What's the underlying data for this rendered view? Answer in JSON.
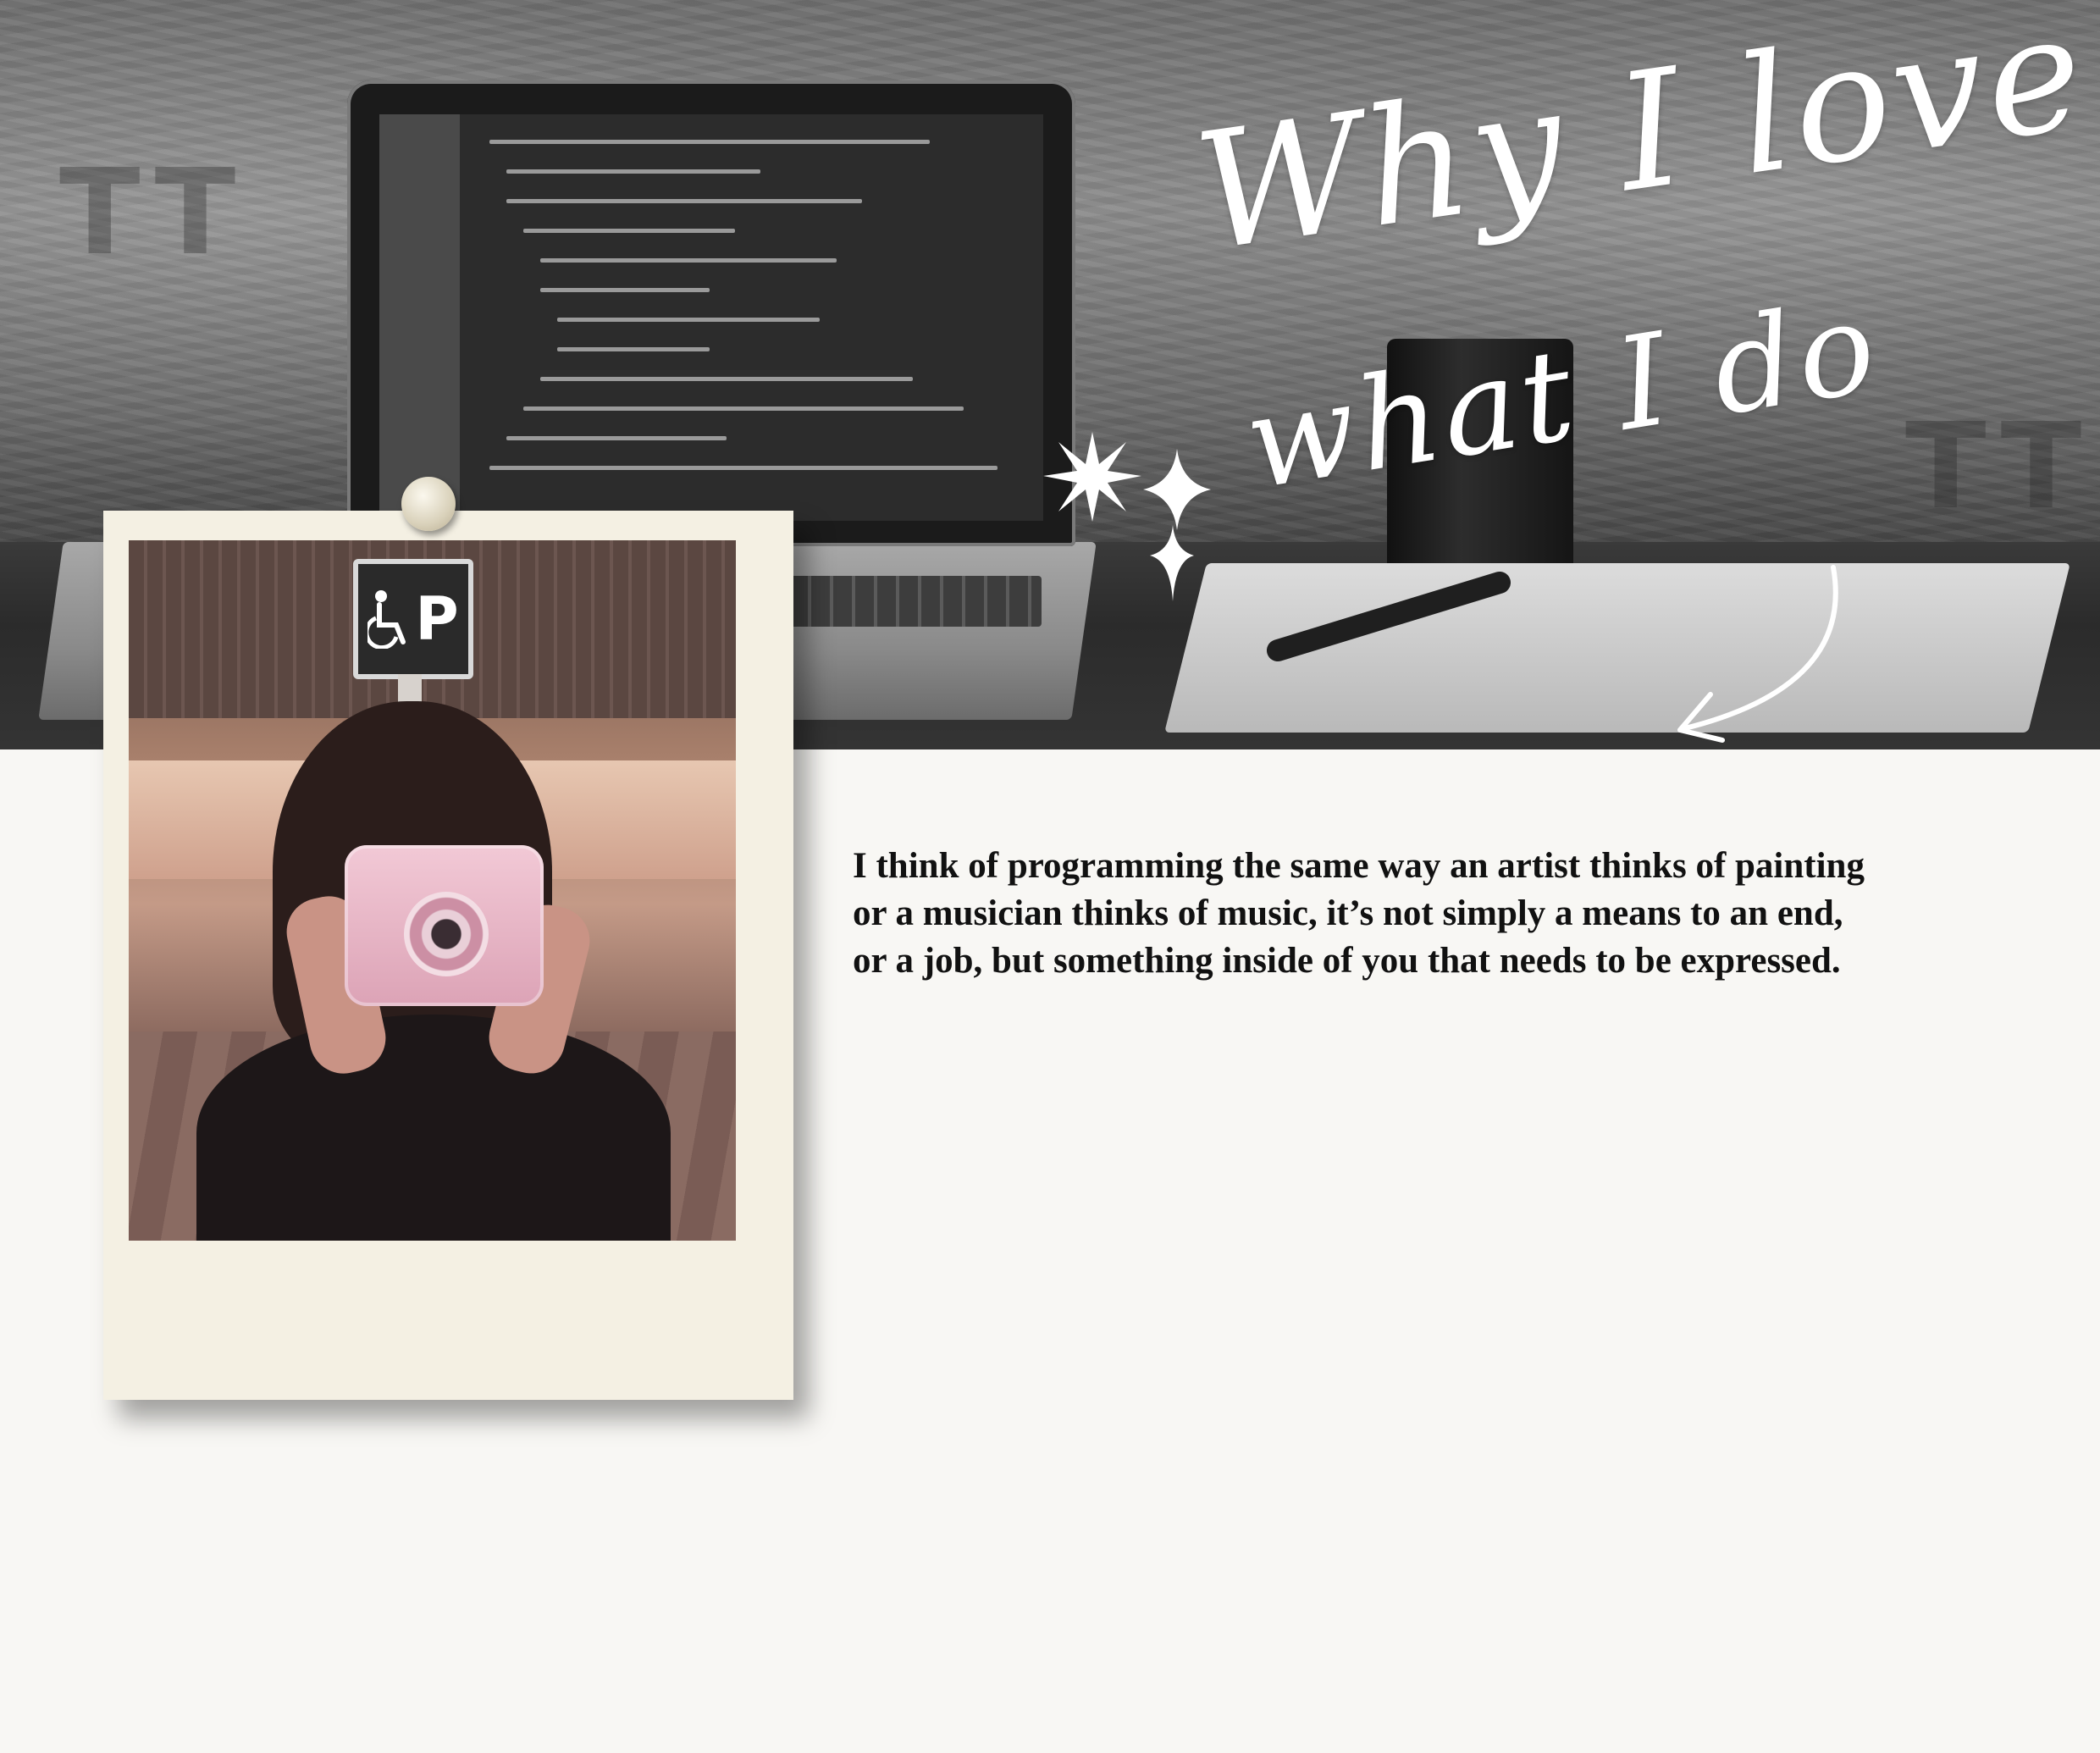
{
  "title": {
    "line1": "Why I love",
    "line2": "what I do"
  },
  "quote": {
    "lines": [
      "I think of programming the same way an artist thinks of painting",
      "or a musician thinks of music, it’s not simply a means to an end,",
      "or a job, but something inside of you that needs to be expressed."
    ]
  },
  "photo": {
    "sign_text": "P",
    "sign_icon": "wheelchair-icon"
  },
  "colors": {
    "page_background": "#f8f7f4",
    "polaroid_frame": "#f4f0e3",
    "title_text": "#ffffff",
    "body_text": "#111111"
  },
  "decorations": {
    "sparkle_icon": "sparkle-icon",
    "arrow_icon": "curved-arrow-icon",
    "pin_icon": "push-pin-icon"
  }
}
